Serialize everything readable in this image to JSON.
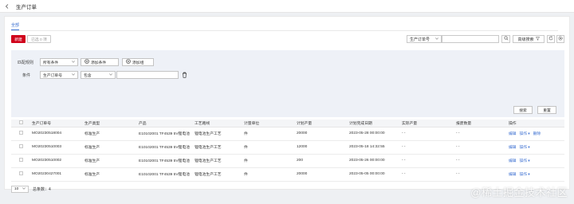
{
  "header": {
    "title": "生产订单"
  },
  "tabs": [
    {
      "label": "全部"
    }
  ],
  "toolbar": {
    "new_label": "新建",
    "selected_label": "已选 0 项",
    "search_field": "生产订单号",
    "search_placeholder": "",
    "advanced_label": "高级搜索"
  },
  "filter": {
    "match_rule_label": "匹配规则",
    "match_rule_value": "所有条件",
    "add_condition_label": "添加条件",
    "add_group_label": "添加组",
    "condition_label": "条件",
    "condition_field": "生产订单号",
    "condition_operator": "包含",
    "condition_value": "",
    "search_label": "搜索",
    "reset_label": "重置"
  },
  "table": {
    "columns": [
      "生产订单号",
      "生产类型",
      "产品",
      "工艺路线",
      "计量单位",
      "计划产量",
      "计划完成日期",
      "实际产量",
      "报废数量",
      "操作"
    ],
    "rows": [
      {
        "order_no": "MO20230518004",
        "type": "标准生产",
        "product": "E10102001 TF4539 5V锂电池",
        "route": "锂电池生产工艺",
        "unit": "件",
        "planned_qty": "20000",
        "due_date": "2023-05-28 00:00:00",
        "actual_qty": "- -",
        "scrap_qty": "- -",
        "actions": [
          "编辑",
          "操作",
          "删除"
        ]
      },
      {
        "order_no": "MO20230510003",
        "type": "标准生产",
        "product": "E10102001 TF4539 5V锂电池",
        "route": "锂电池生产工艺",
        "unit": "件",
        "planned_qty": "12000",
        "due_date": "2023-05-18 14:32:55",
        "actual_qty": "- -",
        "scrap_qty": "- -",
        "actions": [
          "编辑",
          "操作"
        ]
      },
      {
        "order_no": "MO20230510002",
        "type": "标准生产",
        "product": "E10102001 TF4539 5V锂电池",
        "route": "锂电池生产工艺",
        "unit": "件",
        "planned_qty": "200",
        "due_date": "2023-05-26 00:00:00",
        "actual_qty": "- -",
        "scrap_qty": "- -",
        "actions": [
          "编辑",
          "操作"
        ]
      },
      {
        "order_no": "MO20230427001",
        "type": "标准生产",
        "product": "E10102001 TF4539 5V锂电池",
        "route": "锂电池生产工艺",
        "unit": "件",
        "planned_qty": "20000",
        "due_date": "2023-05-05 00:00:00",
        "actual_qty": "- -",
        "scrap_qty": "- -",
        "actions": [
          "编辑",
          "操作"
        ]
      }
    ]
  },
  "pagination": {
    "page_size": "10",
    "total_label": "总条数：4"
  },
  "watermark": "@稀土掘金技术社区",
  "colors": {
    "primary": "#d0021b",
    "link": "#3b6fd1",
    "panel_bg": "#eef1f7"
  },
  "icons": [
    "back-icon",
    "search-icon",
    "filter-icon",
    "refresh-icon",
    "settings-icon",
    "plus-circle-icon",
    "trash-icon",
    "chevron-down-icon"
  ]
}
